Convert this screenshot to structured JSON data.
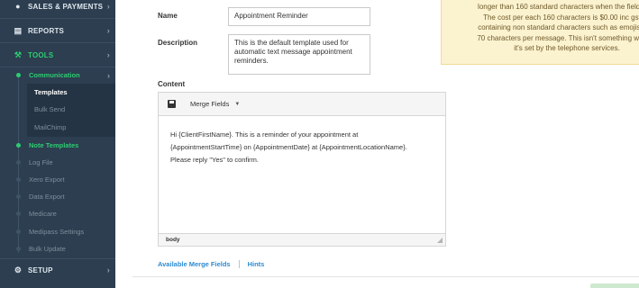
{
  "sidebar": {
    "top_items": [
      {
        "label": "SALES & PAYMENTS",
        "icon": "dollar-icon"
      },
      {
        "label": "REPORTS",
        "icon": "bar-chart-icon"
      },
      {
        "label": "TOOLS",
        "icon": "wrench-icon"
      }
    ],
    "tools_children": {
      "communication": "Communication",
      "templates": "Templates",
      "bulk_send": "Bulk Send",
      "mailchimp": "MailChimp",
      "note_templates": "Note Templates",
      "log_file": "Log File",
      "xero_export": "Xero Export",
      "data_export": "Data Export",
      "medicare": "Medicare",
      "medipass_settings": "Medipass Settings",
      "bulk_update": "Bulk Update"
    },
    "setup": {
      "label": "SETUP",
      "icon": "gear-icon"
    },
    "colors": {
      "background": "#2c3e50",
      "accent": "#2ecc71"
    }
  },
  "form": {
    "name_label": "Name",
    "name_value": "Appointment Reminder",
    "description_label": "Description",
    "description_value": "This is the default template used for automatic text message appointment reminders.",
    "content_label": "Content"
  },
  "editor": {
    "save_icon": "floppy-disk-icon",
    "merge_fields_label": "Merge Fields",
    "content_lines": [
      "Hi {ClientFirstName}. This is a reminder of your appointment at",
      "{AppointmentStartTime} on {AppointmentDate} at {AppointmentLocationName}.",
      "Please reply \"Yes\" to confirm."
    ],
    "status_path": "body"
  },
  "links": {
    "available_merge_fields": "Available Merge Fields",
    "hints": "Hints"
  },
  "notice": {
    "lines": [
      "longer than 160 standard characters when the fields are",
      "The cost per each 160 characters is $0.00 inc gst. M",
      "containing non standard characters such as emojis, hav",
      "70 characters per message. This isn't something we can",
      "it's set by the telephone services."
    ],
    "colors": {
      "background": "#fbf2cf",
      "text": "#6f5a2a"
    }
  }
}
